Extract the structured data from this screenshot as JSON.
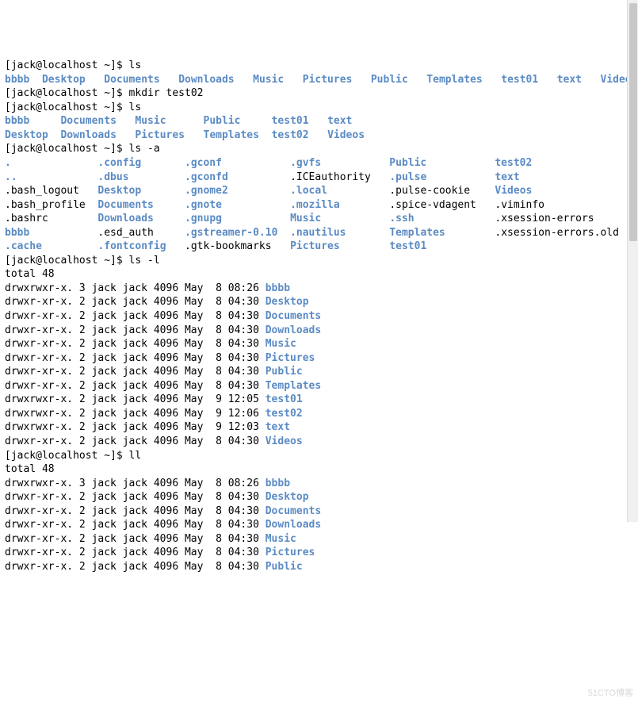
{
  "prompt": "[jack@localhost ~]$ ",
  "commands": {
    "ls": "ls",
    "mkdir": "mkdir test02",
    "lsa": "ls -a",
    "lsl": "ls -l",
    "ll": "ll"
  },
  "ls_items": [
    {
      "t": "bbbb",
      "d": true
    },
    {
      "t": "Desktop",
      "d": true
    },
    {
      "t": "Documents",
      "d": true
    },
    {
      "t": "Downloads",
      "d": true
    },
    {
      "t": "Music",
      "d": true
    },
    {
      "t": "Pictures",
      "d": true
    },
    {
      "t": "Public",
      "d": true
    },
    {
      "t": "Templates",
      "d": true
    },
    {
      "t": "test01",
      "d": true
    },
    {
      "t": "text",
      "d": true
    },
    {
      "t": "Videos",
      "d": true
    }
  ],
  "ls2_row1": [
    {
      "t": "bbbb",
      "d": true
    },
    {
      "t": "Documents",
      "d": true
    },
    {
      "t": "Music",
      "d": true
    },
    {
      "t": "Public",
      "d": true
    },
    {
      "t": "test01",
      "d": true
    },
    {
      "t": "text",
      "d": true
    }
  ],
  "ls2_row2": [
    {
      "t": "Desktop",
      "d": true
    },
    {
      "t": "Downloads",
      "d": true
    },
    {
      "t": "Pictures",
      "d": true
    },
    {
      "t": "Templates",
      "d": true
    },
    {
      "t": "test02",
      "d": true
    },
    {
      "t": "Videos",
      "d": true
    }
  ],
  "lsa_grid": [
    [
      {
        "t": ".",
        "d": true
      },
      {
        "t": ".config",
        "d": true
      },
      {
        "t": ".gconf",
        "d": true
      },
      {
        "t": ".gvfs",
        "d": true
      },
      {
        "t": "Public",
        "d": true
      },
      {
        "t": "test02",
        "d": true
      }
    ],
    [
      {
        "t": "..",
        "d": true
      },
      {
        "t": ".dbus",
        "d": true
      },
      {
        "t": ".gconfd",
        "d": true
      },
      {
        "t": ".ICEauthority",
        "d": false
      },
      {
        "t": ".pulse",
        "d": true
      },
      {
        "t": "text",
        "d": true
      }
    ],
    [
      {
        "t": ".bash_logout",
        "d": false
      },
      {
        "t": "Desktop",
        "d": true
      },
      {
        "t": ".gnome2",
        "d": true
      },
      {
        "t": ".local",
        "d": true
      },
      {
        "t": ".pulse-cookie",
        "d": false
      },
      {
        "t": "Videos",
        "d": true
      }
    ],
    [
      {
        "t": ".bash_profile",
        "d": false
      },
      {
        "t": "Documents",
        "d": true
      },
      {
        "t": ".gnote",
        "d": true
      },
      {
        "t": ".mozilla",
        "d": true
      },
      {
        "t": ".spice-vdagent",
        "d": false
      },
      {
        "t": ".viminfo",
        "d": false
      }
    ],
    [
      {
        "t": ".bashrc",
        "d": false
      },
      {
        "t": "Downloads",
        "d": true
      },
      {
        "t": ".gnupg",
        "d": true
      },
      {
        "t": "Music",
        "d": true
      },
      {
        "t": ".ssh",
        "d": true
      },
      {
        "t": ".xsession-errors",
        "d": false
      }
    ],
    [
      {
        "t": "bbbb",
        "d": true
      },
      {
        "t": ".esd_auth",
        "d": false
      },
      {
        "t": ".gstreamer-0.10",
        "d": true
      },
      {
        "t": ".nautilus",
        "d": true
      },
      {
        "t": "Templates",
        "d": true
      },
      {
        "t": ".xsession-errors.old",
        "d": false
      }
    ],
    [
      {
        "t": ".cache",
        "d": true
      },
      {
        "t": ".fontconfig",
        "d": true
      },
      {
        "t": ".gtk-bookmarks",
        "d": false
      },
      {
        "t": "Pictures",
        "d": true
      },
      {
        "t": "test01",
        "d": true
      },
      {
        "t": "",
        "d": false
      }
    ]
  ],
  "lsa_col_widths": [
    15,
    14,
    17,
    16,
    17,
    0
  ],
  "lsl_total": "total 48",
  "lsl_rows": [
    {
      "perm": "drwxrwxr-x.",
      "n": "3",
      "u": "jack",
      "g": "jack",
      "s": "4096",
      "m": "May",
      "d": " 8",
      "t": "08:26",
      "name": "bbbb"
    },
    {
      "perm": "drwxr-xr-x.",
      "n": "2",
      "u": "jack",
      "g": "jack",
      "s": "4096",
      "m": "May",
      "d": " 8",
      "t": "04:30",
      "name": "Desktop"
    },
    {
      "perm": "drwxr-xr-x.",
      "n": "2",
      "u": "jack",
      "g": "jack",
      "s": "4096",
      "m": "May",
      "d": " 8",
      "t": "04:30",
      "name": "Documents"
    },
    {
      "perm": "drwxr-xr-x.",
      "n": "2",
      "u": "jack",
      "g": "jack",
      "s": "4096",
      "m": "May",
      "d": " 8",
      "t": "04:30",
      "name": "Downloads"
    },
    {
      "perm": "drwxr-xr-x.",
      "n": "2",
      "u": "jack",
      "g": "jack",
      "s": "4096",
      "m": "May",
      "d": " 8",
      "t": "04:30",
      "name": "Music"
    },
    {
      "perm": "drwxr-xr-x.",
      "n": "2",
      "u": "jack",
      "g": "jack",
      "s": "4096",
      "m": "May",
      "d": " 8",
      "t": "04:30",
      "name": "Pictures"
    },
    {
      "perm": "drwxr-xr-x.",
      "n": "2",
      "u": "jack",
      "g": "jack",
      "s": "4096",
      "m": "May",
      "d": " 8",
      "t": "04:30",
      "name": "Public"
    },
    {
      "perm": "drwxr-xr-x.",
      "n": "2",
      "u": "jack",
      "g": "jack",
      "s": "4096",
      "m": "May",
      "d": " 8",
      "t": "04:30",
      "name": "Templates"
    },
    {
      "perm": "drwxrwxr-x.",
      "n": "2",
      "u": "jack",
      "g": "jack",
      "s": "4096",
      "m": "May",
      "d": " 9",
      "t": "12:05",
      "name": "test01"
    },
    {
      "perm": "drwxrwxr-x.",
      "n": "2",
      "u": "jack",
      "g": "jack",
      "s": "4096",
      "m": "May",
      "d": " 9",
      "t": "12:06",
      "name": "test02"
    },
    {
      "perm": "drwxrwxr-x.",
      "n": "2",
      "u": "jack",
      "g": "jack",
      "s": "4096",
      "m": "May",
      "d": " 9",
      "t": "12:03",
      "name": "text"
    },
    {
      "perm": "drwxr-xr-x.",
      "n": "2",
      "u": "jack",
      "g": "jack",
      "s": "4096",
      "m": "May",
      "d": " 8",
      "t": "04:30",
      "name": "Videos"
    }
  ],
  "ll_total": "total 48",
  "ll_rows": [
    {
      "perm": "drwxrwxr-x.",
      "n": "3",
      "u": "jack",
      "g": "jack",
      "s": "4096",
      "m": "May",
      "d": " 8",
      "t": "08:26",
      "name": "bbbb"
    },
    {
      "perm": "drwxr-xr-x.",
      "n": "2",
      "u": "jack",
      "g": "jack",
      "s": "4096",
      "m": "May",
      "d": " 8",
      "t": "04:30",
      "name": "Desktop"
    },
    {
      "perm": "drwxr-xr-x.",
      "n": "2",
      "u": "jack",
      "g": "jack",
      "s": "4096",
      "m": "May",
      "d": " 8",
      "t": "04:30",
      "name": "Documents"
    },
    {
      "perm": "drwxr-xr-x.",
      "n": "2",
      "u": "jack",
      "g": "jack",
      "s": "4096",
      "m": "May",
      "d": " 8",
      "t": "04:30",
      "name": "Downloads"
    },
    {
      "perm": "drwxr-xr-x.",
      "n": "2",
      "u": "jack",
      "g": "jack",
      "s": "4096",
      "m": "May",
      "d": " 8",
      "t": "04:30",
      "name": "Music"
    },
    {
      "perm": "drwxr-xr-x.",
      "n": "2",
      "u": "jack",
      "g": "jack",
      "s": "4096",
      "m": "May",
      "d": " 8",
      "t": "04:30",
      "name": "Pictures"
    },
    {
      "perm": "drwxr-xr-x.",
      "n": "2",
      "u": "jack",
      "g": "jack",
      "s": "4096",
      "m": "May",
      "d": " 8",
      "t": "04:30",
      "name": "Public"
    }
  ],
  "watermark": "51CTO博客"
}
